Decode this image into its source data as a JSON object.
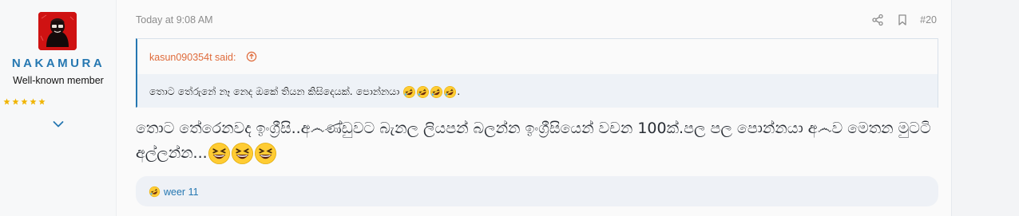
{
  "user": {
    "name": "NAKAMURA",
    "title": "Well-known member",
    "rating": 5
  },
  "post": {
    "time": "Today at 9:08 AM",
    "number": "#20",
    "actions": [
      "share-icon",
      "bookmark-icon"
    ]
  },
  "quote": {
    "author": "kasun090354t said:",
    "text": "තොට තේරුනේ නෑ නෙද ඔකේ තියන කිසිදෙයක්. පොන්නයා",
    "emoji": [
      "rolling-on-floor-laughing",
      "rolling-on-floor-laughing",
      "rolling-on-floor-laughing",
      "rolling-on-floor-laughing"
    ],
    "suffix": "."
  },
  "message": {
    "text": "තොට තේරෙනවද ඉංග්‍රීසි..අ෴ණ්ඩුවට බැනල ලියපන් බලන්න ඉංග්‍රීසියෙන් වචන 100ක්.පල පල පොන්නයා අ෴ව මෙතන මුටටි අල්ලන්න...",
    "emoji": [
      "grinning-squinting",
      "grinning-squinting",
      "grinning-squinting"
    ]
  },
  "reactions": {
    "icon": "rolling-on-floor-laughing",
    "text": "weer 11"
  },
  "colors": {
    "accent": "#2577b1",
    "quote_author": "#df6a3a",
    "avatar_bg": "#d51515",
    "star": "#f0b400"
  }
}
